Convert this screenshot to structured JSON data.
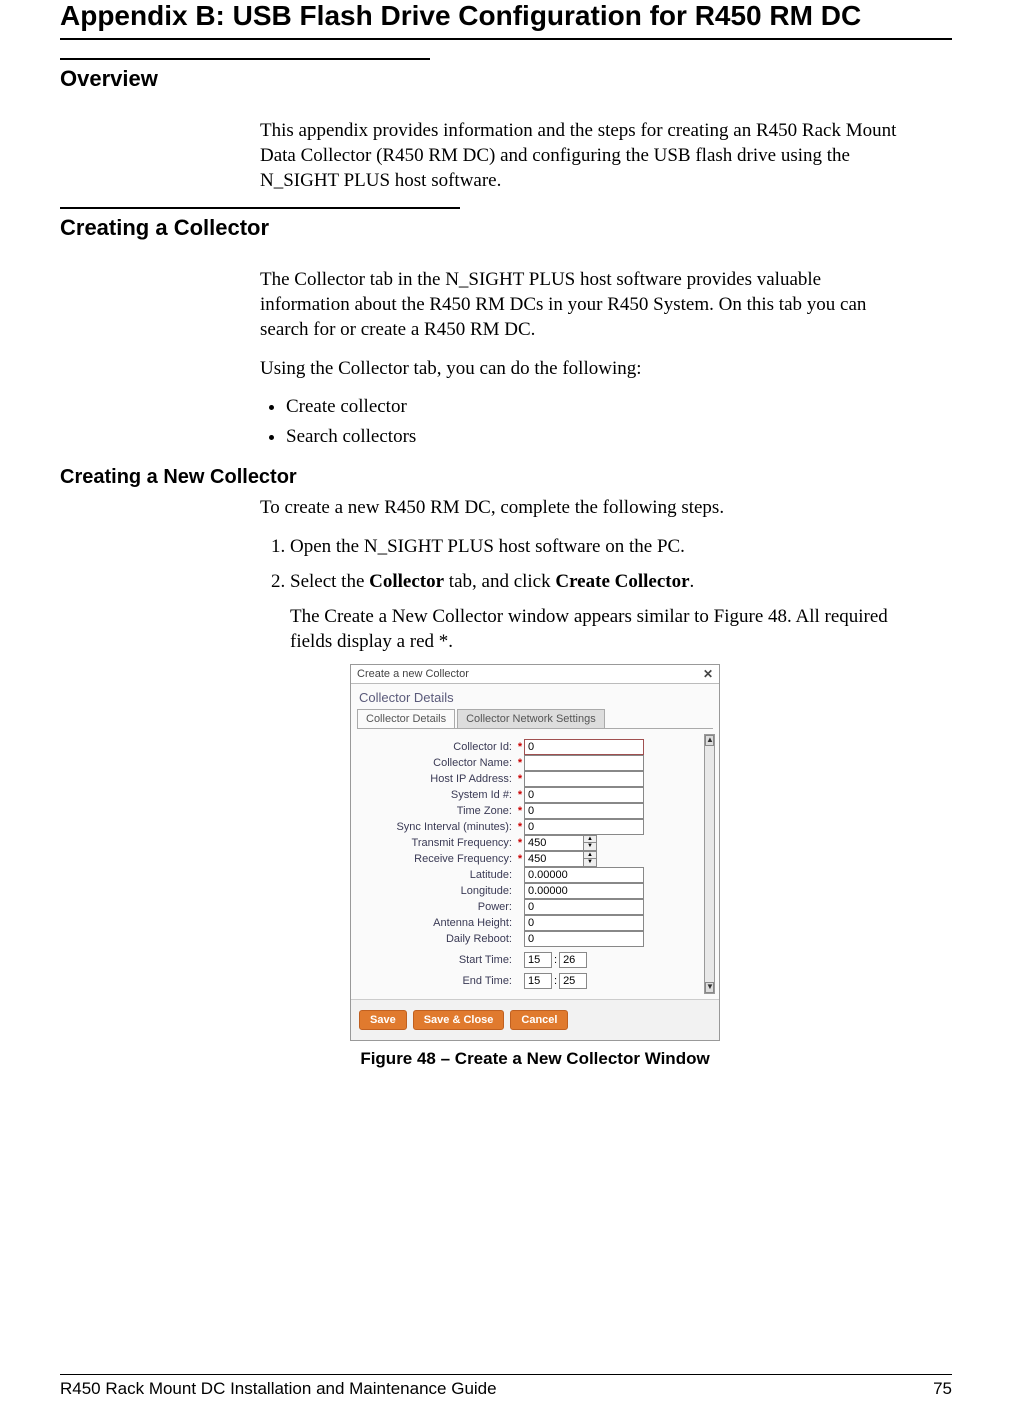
{
  "title": "Appendix B: USB Flash Drive Configuration for R450 RM DC",
  "overview": {
    "heading": "Overview",
    "p": "This appendix provides information and the steps for creating an R450 Rack Mount Data Collector (R450 RM DC) and configuring the USB flash drive using the N_SIGHT PLUS host software."
  },
  "creating": {
    "heading": "Creating a Collector",
    "p1": "The Collector tab in the N_SIGHT PLUS host software provides valuable information about the R450 RM DCs in your R450 System. On this tab you can search for or create a R450 RM DC.",
    "p2": "Using the Collector tab, you can do the following:",
    "bullets": [
      "Create collector",
      "Search collectors"
    ]
  },
  "newcollector": {
    "heading": "Creating a New Collector",
    "intro": "To create a new R450 RM DC, complete the following steps.",
    "step1": "Open the N_SIGHT PLUS host software on the PC.",
    "step2_pre": "Select the ",
    "step2_b1": "Collector",
    "step2_mid": " tab, and click ",
    "step2_b2": "Create Collector",
    "step2_post": ".",
    "step2_p": "The Create a New Collector window appears similar to Figure 48. All required fields display a red ",
    "star": "*",
    "step2_p2": "."
  },
  "dialog": {
    "title": "Create a new Collector",
    "section": "Collector Details",
    "tabs": [
      "Collector Details",
      "Collector Network Settings"
    ],
    "fields": [
      {
        "label": "Collector Id:",
        "req": true,
        "value": "0",
        "cls": "w0"
      },
      {
        "label": "Collector Name:",
        "req": true,
        "value": "",
        "cls": "w1"
      },
      {
        "label": "Host IP Address:",
        "req": true,
        "value": "",
        "cls": "w1"
      },
      {
        "label": "System Id #:",
        "req": true,
        "value": "0",
        "cls": "w1"
      },
      {
        "label": "Time Zone:",
        "req": true,
        "value": "0",
        "cls": "w1"
      },
      {
        "label": "Sync Interval (minutes):",
        "req": true,
        "value": "0",
        "cls": "w1"
      },
      {
        "label": "Transmit Frequency:",
        "req": true,
        "value": "450",
        "cls": "ws",
        "spin": true
      },
      {
        "label": "Receive Frequency:",
        "req": true,
        "value": "450",
        "cls": "ws",
        "spin": true
      },
      {
        "label": "Latitude:",
        "req": false,
        "value": "0.00000",
        "cls": "w1"
      },
      {
        "label": "Longitude:",
        "req": false,
        "value": "0.00000",
        "cls": "w1"
      },
      {
        "label": "Power:",
        "req": false,
        "value": "0",
        "cls": "w1"
      },
      {
        "label": "Antenna Height:",
        "req": false,
        "value": "0",
        "cls": "w1"
      },
      {
        "label": "Daily Reboot:",
        "req": false,
        "value": "0",
        "cls": "w1"
      }
    ],
    "start_time_label": "Start Time:",
    "start_time": [
      "15",
      "26"
    ],
    "end_time_label": "End Time:",
    "end_time": [
      "15",
      "25"
    ],
    "buttons": [
      "Save",
      "Save & Close",
      "Cancel"
    ]
  },
  "figcap": "Figure 48  –  Create a New Collector Window",
  "footer": {
    "left": "R450 Rack Mount DC Installation and Maintenance Guide",
    "right": "75"
  }
}
